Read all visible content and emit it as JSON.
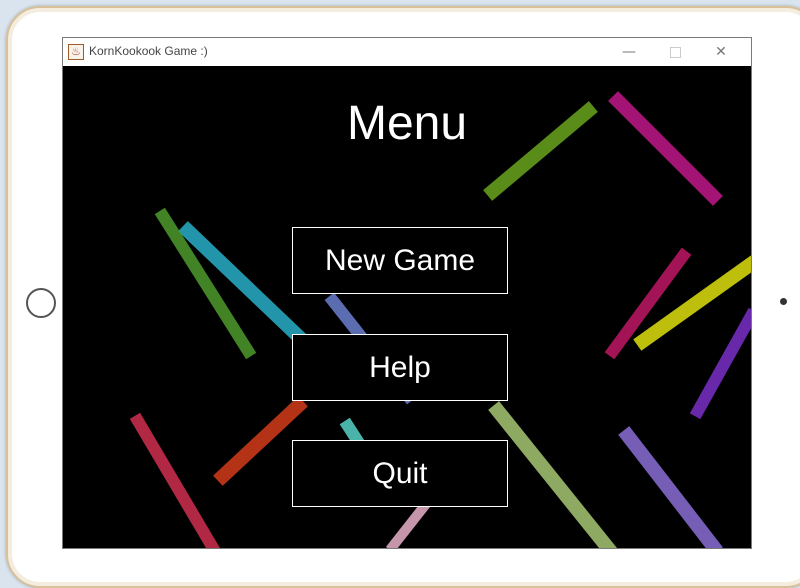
{
  "window": {
    "title": "KornKookook Game :)",
    "minimize_glyph": "—",
    "close_glyph": "✕"
  },
  "menu": {
    "title": "Menu",
    "buttons": {
      "new_game": "New Game",
      "help": "Help",
      "quit": "Quit"
    }
  },
  "background_streaks": [
    {
      "color": "#6aa51f"
    },
    {
      "color": "#c0188a"
    },
    {
      "color": "#2ab0c8"
    },
    {
      "color": "#4e9a2c"
    },
    {
      "color": "#6c7fd1"
    },
    {
      "color": "#d43d1c"
    },
    {
      "color": "#56d3c8"
    },
    {
      "color": "#e8b0c8"
    },
    {
      "color": "#a7c874"
    },
    {
      "color": "#8b6fd6"
    },
    {
      "color": "#e0e010"
    },
    {
      "color": "#c01865"
    },
    {
      "color": "#7a30c8"
    },
    {
      "color": "#d03050"
    }
  ],
  "colors": {
    "canvas_bg": "#000000",
    "menu_text": "#ffffff",
    "button_border": "#ffffff"
  }
}
